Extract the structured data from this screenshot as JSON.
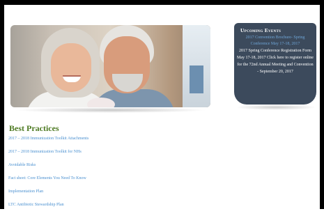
{
  "hero": {
    "image": "smiling-elderly-couple-photo"
  },
  "events": {
    "title": "Upcoming Events",
    "link_text": "2017 Convention Brochure- Spring Conference May 17-18, 2017",
    "body_text": "2017 Spring Conference Registration Form May 17-18, 2017 Click here to register online for the 72nd Annual Meeting and Convention - September 20, 2017"
  },
  "best_practices": {
    "title": "Best Practices",
    "links": [
      "2017 – 2018 Immunization Toolkit Attachments",
      "2017 – 2018 Immunization Toolkit for NHs",
      "Avoidable Risks",
      "Fact sheet: Core Elements You Need To Know",
      "Implementation Plan",
      "LTC Antibiotic Stewardship Plan"
    ]
  },
  "colors": {
    "section_title": "#4e7a23",
    "link": "#4a90d0",
    "events_bg": "#3c4a5c",
    "events_link": "#6fa6d8"
  }
}
